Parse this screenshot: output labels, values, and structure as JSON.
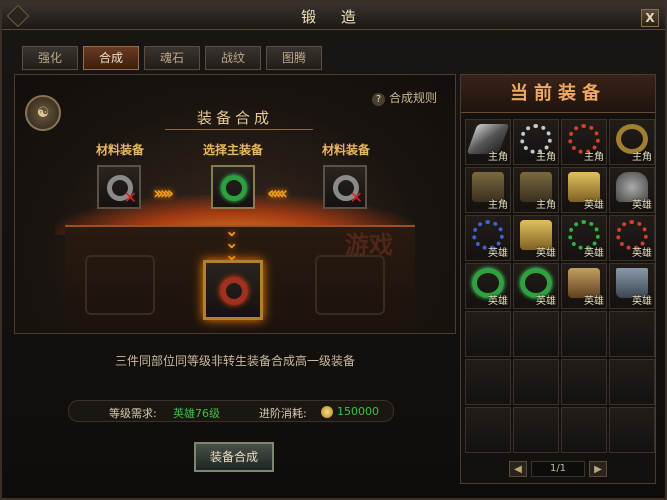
{
  "window": {
    "title": "锻 造",
    "close_label": "X"
  },
  "tabs": [
    {
      "label": "强化",
      "active": false
    },
    {
      "label": "合成",
      "active": true
    },
    {
      "label": "魂石",
      "active": false
    },
    {
      "label": "战纹",
      "active": false
    },
    {
      "label": "图腾",
      "active": false
    }
  ],
  "synthesis": {
    "title": "装备合成",
    "rule_link": "合成规则",
    "rule_icon": "?",
    "material_left_label": "材料装备",
    "main_label": "选择主装备",
    "material_right_label": "材料装备",
    "description": "三件同部位同等级非转生装备合成高一级装备",
    "level_req_label": "等级需求:",
    "level_req_value": "英雄76级",
    "cost_label": "进阶消耗:",
    "cost_value": "150000",
    "button_label": "装备合成"
  },
  "current_equipment": {
    "title": "当前装备",
    "items": [
      {
        "icon": "sword-icon",
        "tag": "主角"
      },
      {
        "icon": "necklace-icon",
        "tag": "主角"
      },
      {
        "icon": "red-necklace-icon",
        "tag": "主角"
      },
      {
        "icon": "gold-ring-icon",
        "tag": "主角"
      },
      {
        "icon": "armor-icon",
        "tag": "主角"
      },
      {
        "icon": "green-armor-icon",
        "tag": "主角"
      },
      {
        "icon": "gold-armor-icon",
        "tag": "英雄"
      },
      {
        "icon": "helmet-icon",
        "tag": "英雄"
      },
      {
        "icon": "blue-necklace-icon",
        "tag": "英雄"
      },
      {
        "icon": "gold-armor-icon",
        "tag": "英雄"
      },
      {
        "icon": "green-necklace-icon",
        "tag": "英雄"
      },
      {
        "icon": "red-necklace-icon",
        "tag": "英雄"
      },
      {
        "icon": "green-ring-icon",
        "tag": "英雄"
      },
      {
        "icon": "green-ring-icon",
        "tag": "英雄"
      },
      {
        "icon": "bracer-icon",
        "tag": "英雄"
      },
      {
        "icon": "boots-icon",
        "tag": "英雄"
      }
    ],
    "empty_slots": 12,
    "page_text": "1/1"
  }
}
